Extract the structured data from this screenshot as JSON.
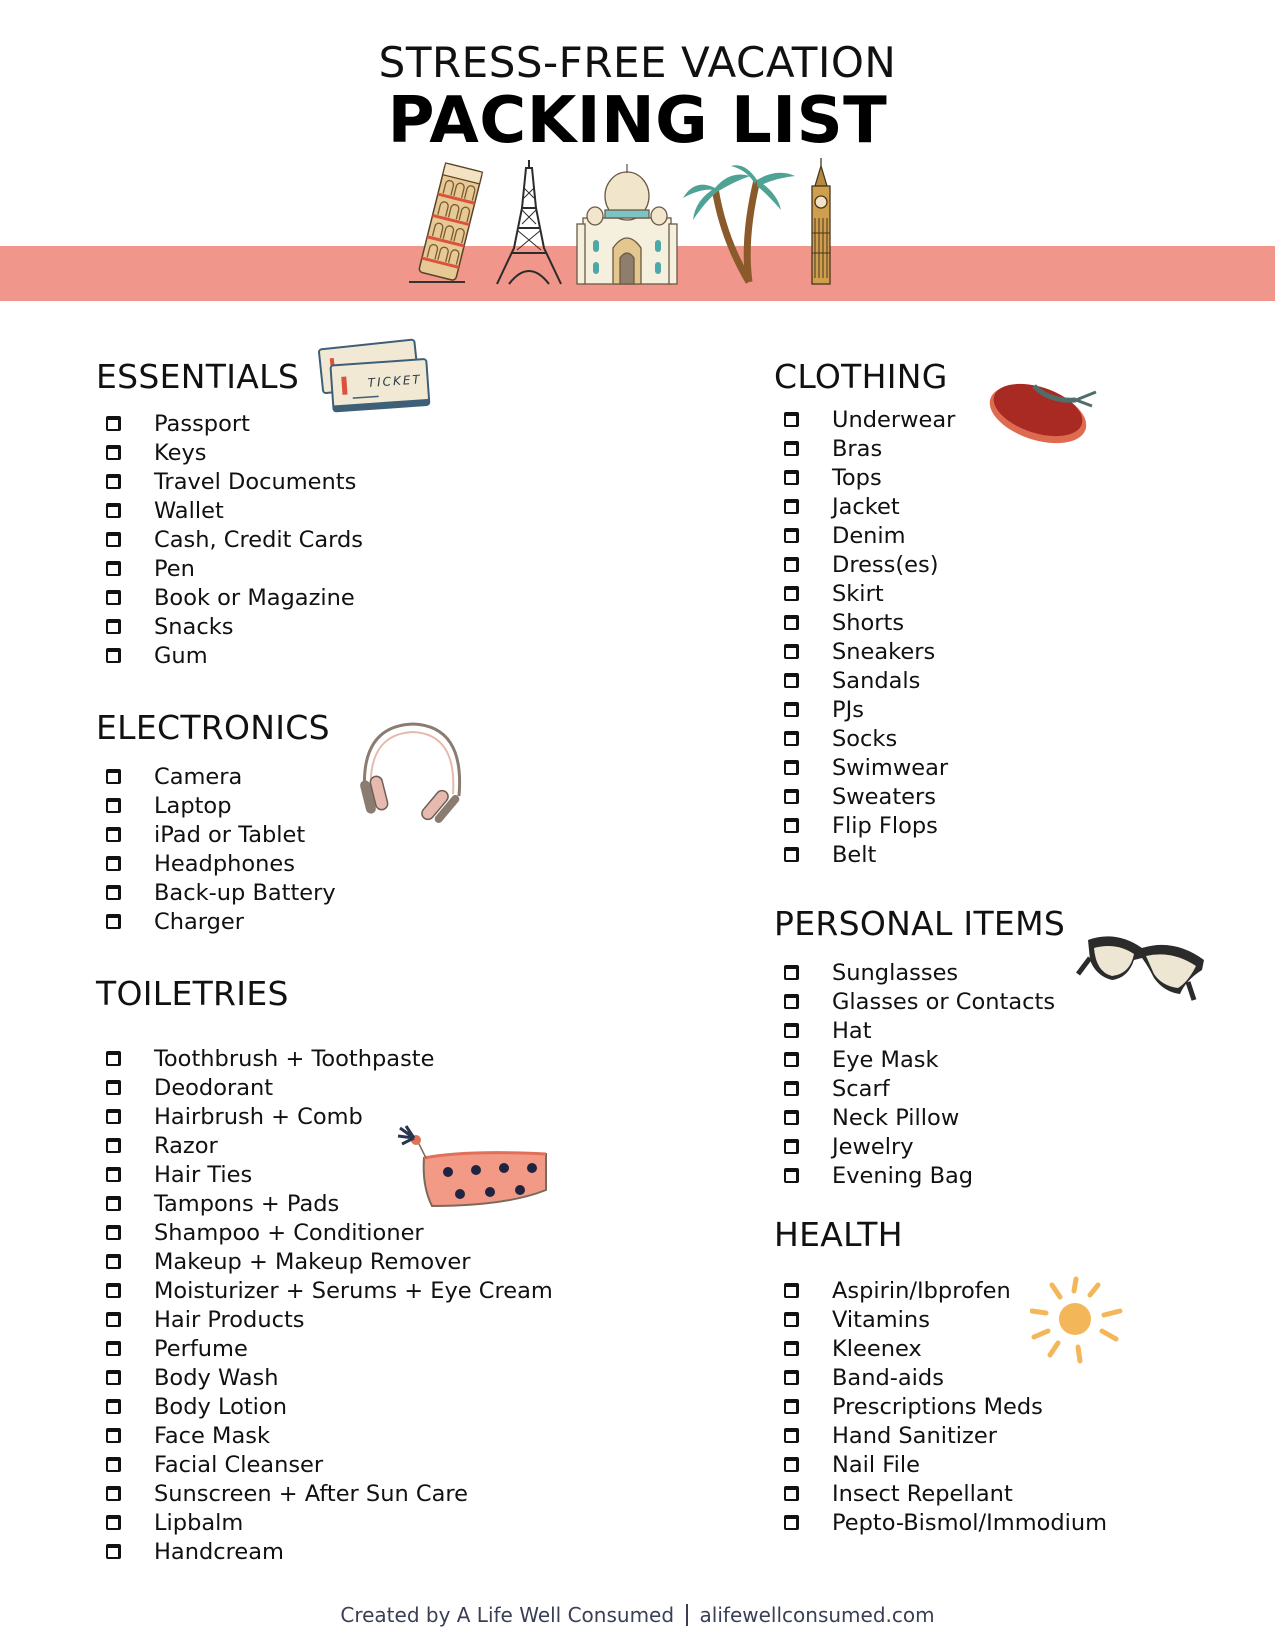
{
  "header": {
    "subtitle": "STRESS-FREE VACATION",
    "title": "PACKING LIST",
    "band_color": "#f0968a",
    "landmarks": [
      "leaning-tower-of-pisa",
      "eiffel-tower",
      "taj-mahal",
      "palm-trees",
      "big-ben"
    ]
  },
  "sections": {
    "essentials": {
      "title": "ESSENTIALS",
      "icon": "ticket-icon",
      "items": [
        "Passport",
        "Keys",
        "Travel Documents",
        "Wallet",
        "Cash, Credit Cards",
        "Pen",
        "Book or Magazine",
        "Snacks",
        "Gum"
      ]
    },
    "electronics": {
      "title": "ELECTRONICS",
      "icon": "headphones-icon",
      "items": [
        "Camera",
        "Laptop",
        "iPad or Tablet",
        "Headphones",
        "Back-up Battery",
        "Charger"
      ]
    },
    "toiletries": {
      "title": "TOILETRIES",
      "icon": "cosmetic-bag-icon",
      "items": [
        "Toothbrush + Toothpaste",
        "Deodorant",
        "Hairbrush + Comb",
        "Razor",
        "Hair Ties",
        "Tampons + Pads",
        "Shampoo + Conditioner",
        "Makeup + Makeup Remover",
        "Moisturizer + Serums + Eye Cream",
        "Hair Products",
        "Perfume",
        "Body Wash",
        "Body Lotion",
        "Face Mask",
        "Facial Cleanser",
        "Sunscreen + After Sun Care",
        "Lipbalm",
        "Handcream"
      ]
    },
    "clothing": {
      "title": "CLOTHING",
      "icon": "sun-hat-icon",
      "items": [
        "Underwear",
        "Bras",
        "Tops",
        "Jacket",
        "Denim",
        "Dress(es)",
        "Skirt",
        "Shorts",
        "Sneakers",
        "Sandals",
        "PJs",
        "Socks",
        "Swimwear",
        "Sweaters",
        "Flip Flops",
        "Belt"
      ]
    },
    "personal": {
      "title": "PERSONAL ITEMS",
      "icon": "sunglasses-icon",
      "items": [
        "Sunglasses",
        "Glasses or Contacts",
        "Hat",
        "Eye Mask",
        "Scarf",
        "Neck Pillow",
        "Jewelry",
        "Evening Bag"
      ]
    },
    "health": {
      "title": "HEALTH",
      "icon": "sun-icon",
      "items": [
        "Aspirin/Ibprofen",
        "Vitamins",
        "Kleenex",
        "Band-aids",
        "Prescriptions Meds",
        "Hand Sanitizer",
        "Nail File",
        "Insect Repellant",
        "Pepto-Bismol/Immodium"
      ]
    }
  },
  "footer": {
    "credit": "Created by A Life Well Consumed",
    "website": "alifewellconsumed.com"
  }
}
